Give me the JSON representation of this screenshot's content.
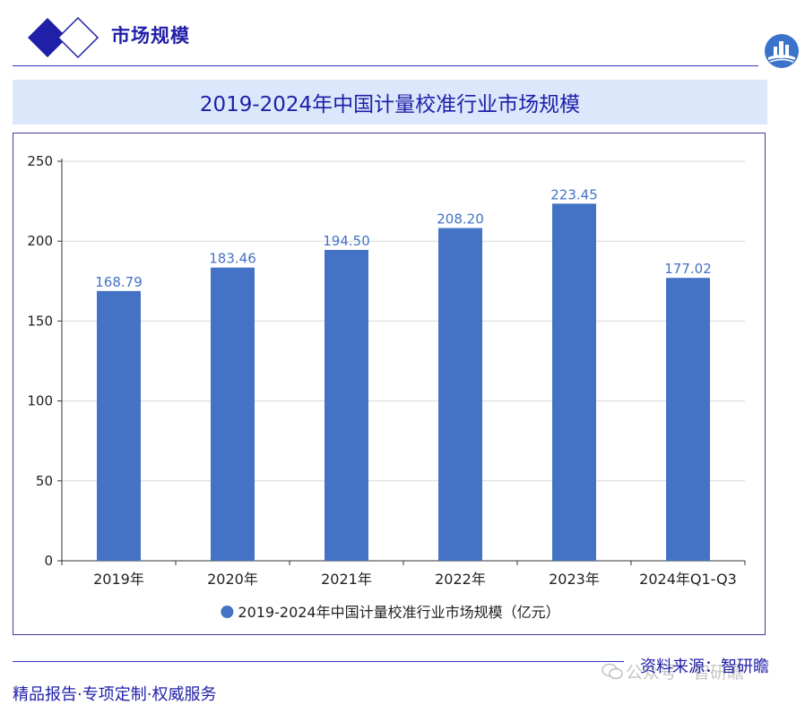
{
  "header": {
    "section_title": "市场规模",
    "line_color": "#3636b4",
    "accent_color": "#1f1fa8"
  },
  "chart_title": "2019-2024年中国计量校准行业市场规模",
  "chart_data": {
    "type": "bar",
    "categories": [
      "2019年",
      "2020年",
      "2021年",
      "2022年",
      "2023年",
      "2024年Q1-Q3"
    ],
    "series": [
      {
        "name": "2019-2024年中国计量校准行业市场规模（亿元）",
        "values": [
          168.79,
          183.46,
          194.5,
          208.2,
          223.45,
          177.02
        ],
        "value_labels": [
          "168.79",
          "183.46",
          "194.50",
          "208.20",
          "223.45",
          "177.02"
        ],
        "color": "#4472c4"
      }
    ],
    "ylim": [
      0,
      250
    ],
    "yticks": [
      0,
      50,
      100,
      150,
      200,
      250
    ],
    "grid": true,
    "legend_position": "bottom"
  },
  "footer": {
    "source": "资料来源：智研瞻",
    "slogan": "精品报告·专项定制·权威服务",
    "watermark": "公众号 · 智研瞻"
  }
}
